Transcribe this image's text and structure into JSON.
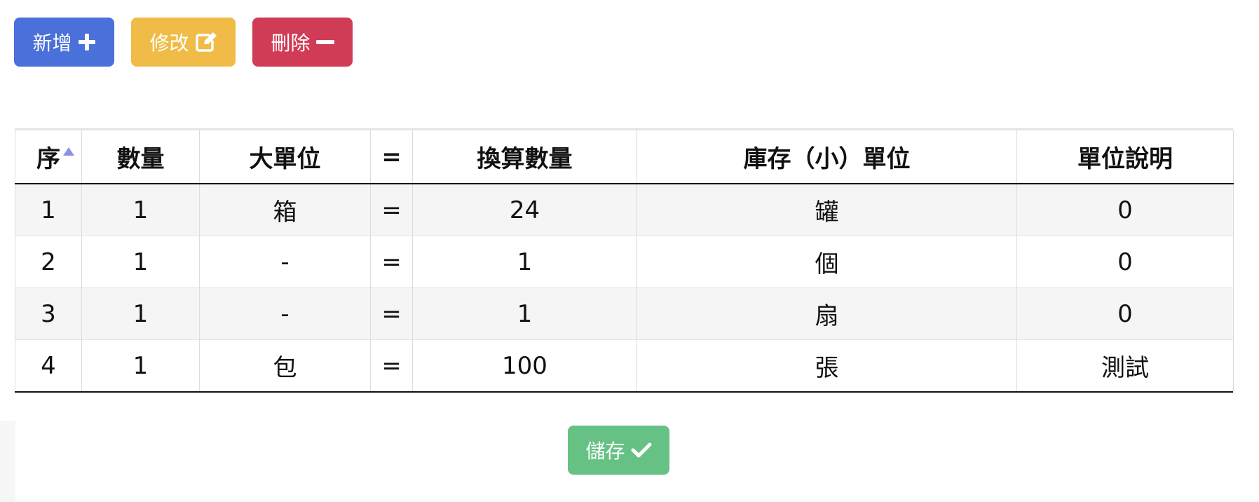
{
  "toolbar": {
    "add_label": "新增",
    "add_icon": "plus-icon",
    "add_color": "#4a70d9",
    "edit_label": "修改",
    "edit_icon": "edit-icon",
    "edit_color": "#f0bc47",
    "delete_label": "刪除",
    "delete_icon": "minus-icon",
    "delete_color": "#d03b55"
  },
  "table": {
    "sort_icon": "sort-ascending-icon",
    "columns": [
      "序",
      "數量",
      "大單位",
      "=",
      "換算數量",
      "庫存（小）單位",
      "單位說明"
    ],
    "rows": [
      [
        "1",
        "1",
        "箱",
        "=",
        "24",
        "罐",
        "0"
      ],
      [
        "2",
        "1",
        "-",
        "=",
        "1",
        "個",
        "0"
      ],
      [
        "3",
        "1",
        "-",
        "=",
        "1",
        "扇",
        "0"
      ],
      [
        "4",
        "1",
        "包",
        "=",
        "100",
        "張",
        "測試"
      ]
    ]
  },
  "save": {
    "label": "儲存",
    "icon": "check-icon",
    "color": "#66c185"
  }
}
